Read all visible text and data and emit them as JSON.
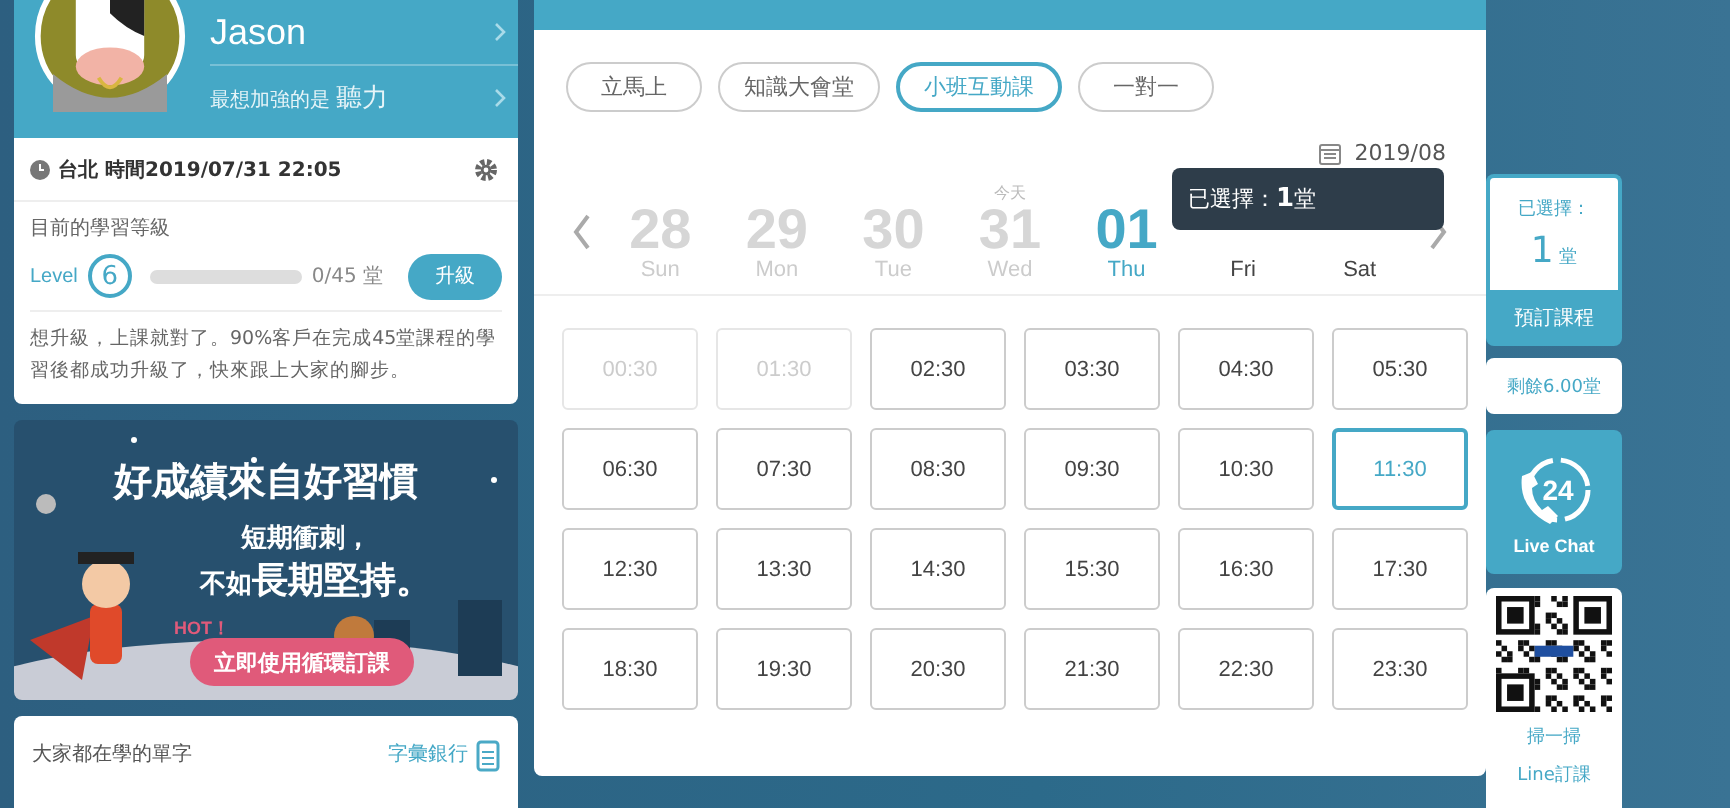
{
  "profile": {
    "name": "Jason",
    "focus_label": "最想加強的是",
    "focus_value": "聽力"
  },
  "clock": {
    "text": "台北 時間2019/07/31 22:05"
  },
  "level": {
    "heading": "目前的學習等級",
    "label": "Level",
    "number": "6",
    "level": 0,
    "progress": "0/45 堂",
    "upgrade": "升級",
    "note": "想升級，上課就對了。90%客戶在完成45堂課程的學習後都成功升級了，快來跟上大家的腳步。"
  },
  "banner": {
    "headline": "好成績來自好習慣",
    "line1": "短期衝刺，",
    "line2a": "不如",
    "line2b": "長期堅持。",
    "hot": "HOT！",
    "button": "立即使用循環訂課"
  },
  "words": {
    "title": "大家都在學的單字",
    "link": "字彙銀行"
  },
  "tabs": [
    {
      "label": "立馬上",
      "selected": false
    },
    {
      "label": "知識大會堂",
      "selected": false
    },
    {
      "label": "小班互動課",
      "selected": true
    },
    {
      "label": "一對一",
      "selected": false
    }
  ],
  "month": "2019/08",
  "days": [
    {
      "num": "28",
      "dow": "Sun",
      "kind": "past",
      "selected": false
    },
    {
      "num": "29",
      "dow": "Mon",
      "kind": "past",
      "selected": false
    },
    {
      "num": "30",
      "dow": "Tue",
      "kind": "past",
      "selected": false
    },
    {
      "num": "31",
      "dow": "Wed",
      "kind": "past",
      "selected": false,
      "tag": "今天"
    },
    {
      "num": "01",
      "dow": "Thu",
      "kind": "open",
      "selected": true
    },
    {
      "dow": "Fri",
      "kind": "open",
      "selected": false
    },
    {
      "dow": "Sat",
      "kind": "open",
      "selected": false
    }
  ],
  "tooltip": {
    "label": "已選擇：",
    "count": "1",
    "unit": "堂"
  },
  "slots": [
    {
      "time": "00:30",
      "disabled": true,
      "selected": false
    },
    {
      "time": "01:30",
      "disabled": true,
      "selected": false
    },
    {
      "time": "02:30",
      "disabled": false,
      "selected": false
    },
    {
      "time": "03:30",
      "disabled": false,
      "selected": false
    },
    {
      "time": "04:30",
      "disabled": false,
      "selected": false
    },
    {
      "time": "05:30",
      "disabled": false,
      "selected": false
    },
    {
      "time": "06:30",
      "disabled": false,
      "selected": false
    },
    {
      "time": "07:30",
      "disabled": false,
      "selected": false
    },
    {
      "time": "08:30",
      "disabled": false,
      "selected": false
    },
    {
      "time": "09:30",
      "disabled": false,
      "selected": false
    },
    {
      "time": "10:30",
      "disabled": false,
      "selected": false
    },
    {
      "time": "11:30",
      "disabled": false,
      "selected": true
    },
    {
      "time": "12:30",
      "disabled": false,
      "selected": false
    },
    {
      "time": "13:30",
      "disabled": false,
      "selected": false
    },
    {
      "time": "14:30",
      "disabled": false,
      "selected": false
    },
    {
      "time": "15:30",
      "disabled": false,
      "selected": false
    },
    {
      "time": "16:30",
      "disabled": false,
      "selected": false
    },
    {
      "time": "17:30",
      "disabled": false,
      "selected": false
    },
    {
      "time": "18:30",
      "disabled": false,
      "selected": false
    },
    {
      "time": "19:30",
      "disabled": false,
      "selected": false
    },
    {
      "time": "20:30",
      "disabled": false,
      "selected": false
    },
    {
      "time": "21:30",
      "disabled": false,
      "selected": false
    },
    {
      "time": "22:30",
      "disabled": false,
      "selected": false
    },
    {
      "time": "23:30",
      "disabled": false,
      "selected": false
    }
  ],
  "cart": {
    "label": "已選擇：",
    "count": "1",
    "unit": "堂",
    "book": "預訂課程",
    "remaining": "剩餘6.00堂"
  },
  "chat": {
    "label": "Live Chat",
    "hours": "24"
  },
  "line": {
    "scan": "掃一掃",
    "book": "Line訂課"
  }
}
